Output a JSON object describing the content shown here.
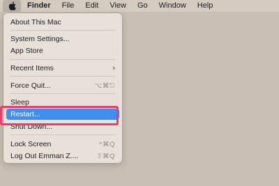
{
  "menubar": {
    "apple_icon": "apple-logo-icon",
    "items": [
      "Finder",
      "File",
      "Edit",
      "View",
      "Go",
      "Window",
      "Help"
    ]
  },
  "apple_menu": {
    "items": [
      {
        "label": "About This Mac"
      },
      {
        "label": "System Settings..."
      },
      {
        "label": "App Store"
      },
      {
        "label": "Recent Items",
        "submenu_icon": "chevron-right-icon"
      },
      {
        "label": "Force Quit...",
        "shortcut": "⌥⌘⎋"
      },
      {
        "label": "Sleep"
      },
      {
        "label": "Restart...",
        "selected": true
      },
      {
        "label": "Shut Down..."
      },
      {
        "label": "Lock Screen",
        "shortcut": "^⌘Q"
      },
      {
        "label": "Log Out Emman Z....",
        "shortcut": "⇧⌘Q"
      }
    ]
  },
  "colors": {
    "selection": "#3d8ff0",
    "highlight_outline": "#ea3d69",
    "desktop": "#c9bfb4"
  }
}
